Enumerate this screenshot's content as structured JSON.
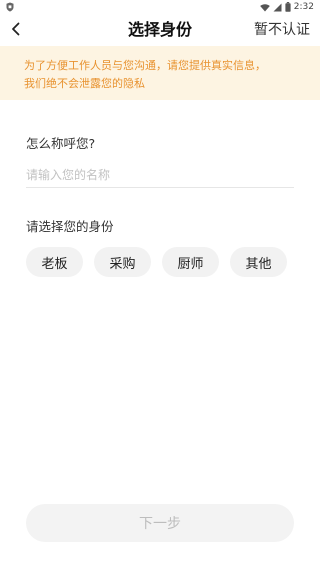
{
  "status_bar": {
    "time": "2:32",
    "left_icon": "shield-icon",
    "icons": [
      "wifi-icon",
      "cell-signal-icon",
      "battery-icon"
    ]
  },
  "nav": {
    "back_icon": "chevron-left-icon",
    "title": "选择身份",
    "skip_label": "暂不认证"
  },
  "notice": {
    "line1": "为了方便工作人员与您沟通，请您提供真实信息，",
    "line2": "我们绝不会泄露您的隐私",
    "color": "#e8922f",
    "background": "#fdf4e2"
  },
  "form": {
    "name_label": "怎么称呼您?",
    "name_value": "",
    "name_placeholder": "请输入您的名称",
    "role_label": "请选择您的身份",
    "roles": [
      "老板",
      "采购",
      "厨师",
      "其他"
    ]
  },
  "next_button": {
    "label": "下一步",
    "state": "disabled"
  }
}
